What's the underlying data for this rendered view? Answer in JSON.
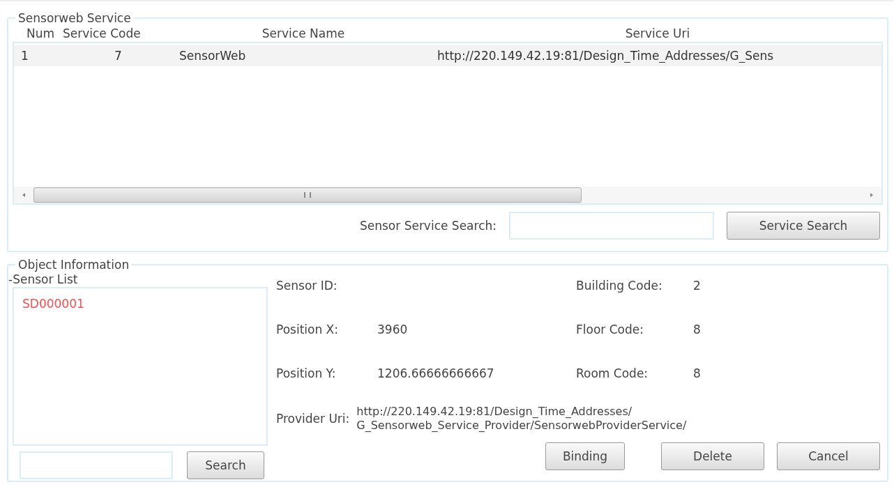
{
  "service_group": {
    "title": "Sensorweb Service",
    "table": {
      "columns": [
        "Num",
        "Service Code",
        "Service Name",
        "Service Uri"
      ],
      "rows": [
        {
          "cells": [
            "1",
            "7",
            "SensorWeb",
            "http://220.149.42.19:81/Design_Time_Addresses/G_Sens"
          ],
          "selected": true
        }
      ]
    },
    "search_label": "Sensor Service Search:",
    "search_button": "Service Search"
  },
  "object_group": {
    "title": "Object Information",
    "list_title": "-Sensor List",
    "sensors": [
      {
        "id": "SD000001",
        "selected": true
      }
    ],
    "search_button": "Search",
    "fields_left": [
      {
        "label": "Sensor ID:"
      },
      {
        "label": "Position X:",
        "value": "3960"
      },
      {
        "label": "Position Y:",
        "value": "1206.66666666667"
      }
    ],
    "fields_right": [
      {
        "label": "Building Code:",
        "value": "2"
      },
      {
        "label": "Floor Code:",
        "value": "8"
      },
      {
        "label": "Room Code:",
        "value": "8"
      }
    ],
    "provider": {
      "label": "Provider Uri:",
      "value": "http://220.149.42.19:81/Design_Time_Addresses/ G_Sensorweb_Service_Provider/SensorwebProviderService/"
    },
    "buttons": [
      "Binding",
      "Delete",
      "Cancel"
    ]
  }
}
